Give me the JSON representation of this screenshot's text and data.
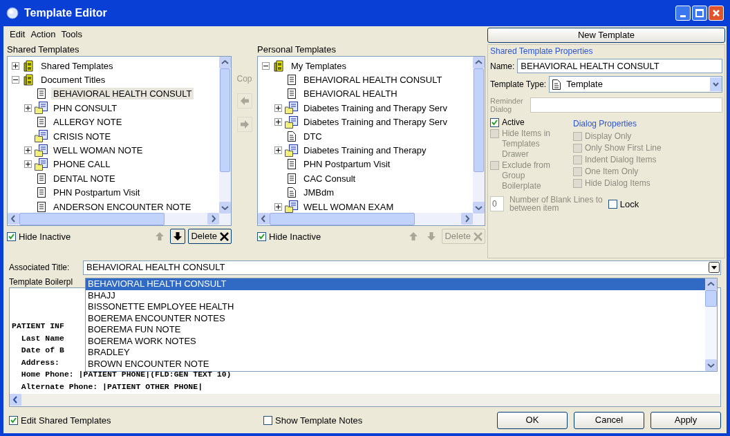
{
  "window": {
    "title": "Template Editor"
  },
  "menu": [
    "Edit",
    "Action",
    "Tools"
  ],
  "shared_templates": {
    "label": "Shared Templates",
    "tree": [
      {
        "label": "Shared Templates",
        "kind": "cabinet",
        "expanded": false,
        "selected": false
      },
      {
        "label": "Document Titles",
        "kind": "cabinet",
        "expanded": true,
        "selected": false,
        "children": [
          {
            "label": "BEHAVIORAL HEALTH CONSULT",
            "kind": "document",
            "selected": true
          },
          {
            "label": "PHN CONSULT",
            "kind": "group",
            "expanded": false,
            "selected": false
          },
          {
            "label": "ALLERGY NOTE",
            "kind": "document",
            "selected": false
          },
          {
            "label": "CRISIS NOTE",
            "kind": "group",
            "selected": false
          },
          {
            "label": "WELL WOMAN NOTE",
            "kind": "group",
            "expanded": false,
            "selected": false
          },
          {
            "label": "PHONE CALL",
            "kind": "group",
            "expanded": false,
            "selected": false
          },
          {
            "label": "DENTAL NOTE",
            "kind": "document",
            "selected": false
          },
          {
            "label": "PHN Postpartum Visit",
            "kind": "document",
            "selected": false
          },
          {
            "label": "ANDERSON ENCOUNTER NOTE",
            "kind": "document",
            "selected": false
          }
        ]
      }
    ],
    "hide_inactive": {
      "label": "Hide Inactive",
      "checked": true
    },
    "buttons": [
      {
        "kind": "up",
        "disabled": true
      },
      {
        "kind": "down",
        "disabled": false
      },
      {
        "kind": "delete",
        "label": "Delete",
        "disabled": false
      }
    ]
  },
  "copy_label": "Cop",
  "copy_buttons": [
    {
      "kind": "left",
      "disabled": true
    },
    {
      "kind": "right",
      "disabled": true
    }
  ],
  "personal_templates": {
    "label": "Personal Templates",
    "tree": [
      {
        "label": "My Templates",
        "kind": "cabinet",
        "expanded": true,
        "selected": false,
        "children": [
          {
            "label": "BEHAVIORAL HEALTH CONSULT",
            "kind": "document",
            "selected": false
          },
          {
            "label": "BEHAVIORAL HEALTH",
            "kind": "document",
            "selected": false
          },
          {
            "label": "Diabetes Training and Therapy Serv",
            "kind": "group",
            "expanded": false,
            "selected": false
          },
          {
            "label": "Diabetes Training and Therapy Serv",
            "kind": "group",
            "expanded": false,
            "selected": false
          },
          {
            "label": "DTC",
            "kind": "page",
            "selected": false
          },
          {
            "label": "Diabetes Training and Therapy",
            "kind": "group",
            "expanded": false,
            "selected": false
          },
          {
            "label": "PHN Postpartum Visit",
            "kind": "document",
            "selected": false
          },
          {
            "label": "CAC Consult",
            "kind": "document",
            "selected": false
          },
          {
            "label": "JMBdm",
            "kind": "page",
            "selected": false
          },
          {
            "label": "WELL WOMAN EXAM",
            "kind": "group",
            "expanded": false,
            "selected": false
          }
        ]
      }
    ],
    "hide_inactive": {
      "label": "Hide Inactive",
      "checked": true
    },
    "buttons": [
      {
        "kind": "up",
        "disabled": true
      },
      {
        "kind": "down",
        "disabled": true
      },
      {
        "kind": "delete",
        "label": "Delete",
        "disabled": true
      }
    ]
  },
  "new_template_button": "New Template",
  "properties": {
    "heading": "Shared Template Properties",
    "name": {
      "label": "Name:",
      "value": "BEHAVIORAL HEALTH CONSULT"
    },
    "template_type": {
      "label": "Template Type:",
      "value": "Template"
    },
    "reminder_dialog": {
      "label": "Reminder Dialog",
      "disabled": true
    },
    "left_checks": [
      {
        "label": "Active",
        "checked": true,
        "disabled": false
      },
      {
        "label": "Hide Items in Templates Drawer",
        "checked": false,
        "disabled": true
      },
      {
        "label": "Exclude from Group Boilerplate",
        "checked": false,
        "disabled": true
      }
    ],
    "dialog_heading": "Dialog Properties",
    "dialog_checks": [
      {
        "label": "Display Only",
        "checked": false,
        "disabled": true
      },
      {
        "label": "Only Show First Line",
        "checked": false,
        "disabled": true
      },
      {
        "label": "Indent Dialog Items",
        "checked": false,
        "disabled": true
      },
      {
        "label": "One Item Only",
        "checked": false,
        "disabled": true
      },
      {
        "label": "Hide Dialog Items",
        "checked": false,
        "disabled": true
      }
    ],
    "blank_lines": {
      "value": "0",
      "label": "Number of Blank Lines to",
      "label_2": "between item"
    },
    "lock": {
      "label": "Lock",
      "checked": false
    }
  },
  "associated_title": {
    "label": "Associated Title:",
    "value": "BEHAVIORAL HEALTH CONSULT",
    "options": [
      {
        "label": "BEHAVIORAL HEALTH CONSULT",
        "selected": true
      },
      {
        "label": "BHAJJ",
        "selected": false
      },
      {
        "label": "BISSONETTE EMPLOYEE HEALTH",
        "selected": false
      },
      {
        "label": "BOEREMA ENCOUNTER NOTES",
        "selected": false
      },
      {
        "label": "BOEREMA FUN NOTE",
        "selected": false
      },
      {
        "label": "BOEREMA WORK NOTES",
        "selected": false
      },
      {
        "label": "BRADLEY",
        "selected": false
      },
      {
        "label": "BROWN ENCOUNTER NOTE",
        "selected": false
      }
    ]
  },
  "boilerplate": {
    "label": "Template Boilerpl",
    "lines": [
      "PATIENT INF",
      "  Last Name",
      "  Date of B",
      "  Address:",
      "  Home Phone: |PATIENT PHONE|(FLD:GEN TEXT 10)",
      "  Alternate Phone: |PATIENT OTHER PHONE|"
    ]
  },
  "footer": {
    "edit_shared": {
      "label": "Edit Shared Templates",
      "checked": true
    },
    "show_notes": {
      "label": "Show Template Notes",
      "checked": false
    },
    "buttons": [
      "OK",
      "Cancel",
      "Apply"
    ]
  }
}
